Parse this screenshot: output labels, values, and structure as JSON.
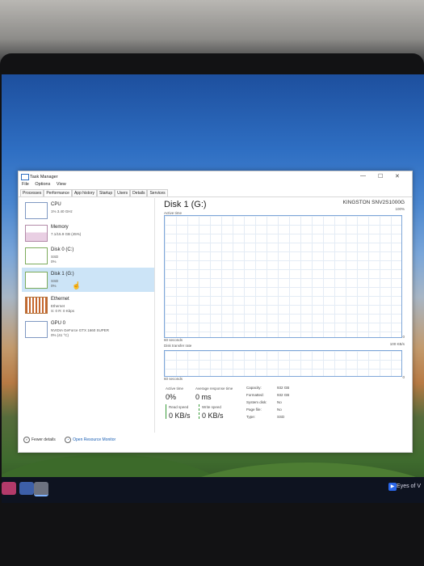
{
  "window": {
    "title": "Task Manager",
    "controls": [
      "—",
      "☐",
      "✕"
    ]
  },
  "menu": [
    "File",
    "Options",
    "View"
  ],
  "tabs": [
    "Processes",
    "Performance",
    "App history",
    "Startup",
    "Users",
    "Details",
    "Services"
  ],
  "active_tab": "Performance",
  "sidebar": [
    {
      "name": "CPU",
      "sub1": "1% 3.40 GHz",
      "sub2": ""
    },
    {
      "name": "Memory",
      "sub1": "7.1/15.9 GB (45%)",
      "sub2": ""
    },
    {
      "name": "Disk 0 (C:)",
      "sub1": "SSD",
      "sub2": "0%"
    },
    {
      "name": "Disk 1 (G:)",
      "sub1": "SSD",
      "sub2": "0%",
      "selected": true
    },
    {
      "name": "Ethernet",
      "sub1": "Ethernet",
      "sub2": "S: 0 R: 0 Kbps"
    },
    {
      "name": "GPU 0",
      "sub1": "NVIDIA GeForce GTX 1660 SUPER",
      "sub2": "0% (41 °C)"
    }
  ],
  "detail": {
    "title": "Disk 1 (G:)",
    "model": "KINGSTON SNV2S1000G",
    "active_time_label": "Active time",
    "active_time_max": "100%",
    "sixty_seconds": "60 seconds",
    "zero": "0",
    "transfer_label": "Disk transfer rate",
    "transfer_max": "100 KB/s",
    "active_time_head": "Active time",
    "active_time_value": "0%",
    "avg_resp_head": "Average response time",
    "avg_resp_value": "0 ms",
    "read_head": "Read speed",
    "read_value": "0 KB/s",
    "write_head": "Write speed",
    "write_value": "0 KB/s",
    "props": [
      {
        "k": "Capacity:",
        "v": "932 GB"
      },
      {
        "k": "Formatted:",
        "v": "932 GB"
      },
      {
        "k": "System disk:",
        "v": "No"
      },
      {
        "k": "Page file:",
        "v": "No"
      },
      {
        "k": "Type:",
        "v": "SSD"
      }
    ]
  },
  "footer": {
    "fewer": "Fewer details",
    "monitor": "Open Resource Monitor"
  },
  "taskbar": {
    "media_title": "Eyes of V"
  }
}
